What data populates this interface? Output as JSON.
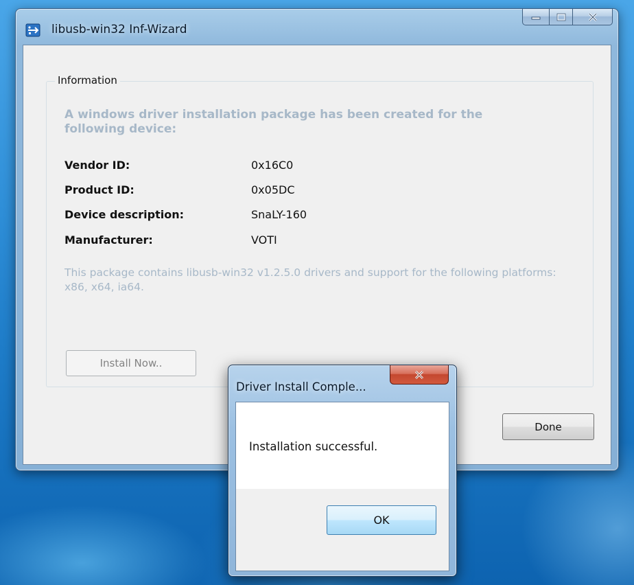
{
  "main_window": {
    "title": "libusb-win32 Inf-Wizard",
    "group_title": "Information",
    "heading": "A windows driver installation package has been created for the following device:",
    "fields": [
      {
        "label": "Vendor ID:",
        "value": "0x16C0"
      },
      {
        "label": "Product ID:",
        "value": "0x05DC"
      },
      {
        "label": "Device description:",
        "value": "SnaLY-160"
      },
      {
        "label": "Manufacturer:",
        "value": "VOTI"
      }
    ],
    "package_note": "This package contains libusb-win32 v1.2.5.0 drivers and support for the following platforms: x86, x64, ia64.",
    "install_button": "Install Now..",
    "done_button": "Done"
  },
  "dialog": {
    "title": "Driver Install Comple...",
    "message": "Installation successful.",
    "ok_button": "OK"
  },
  "colors": {
    "desktop": "#2f8fd8",
    "heading_disabled": "#a7b8c8",
    "close_button": "#c4472f"
  },
  "icons": {
    "app": "usb-app-icon",
    "minimize": "minimize-icon",
    "maximize": "maximize-icon",
    "close": "close-icon"
  }
}
